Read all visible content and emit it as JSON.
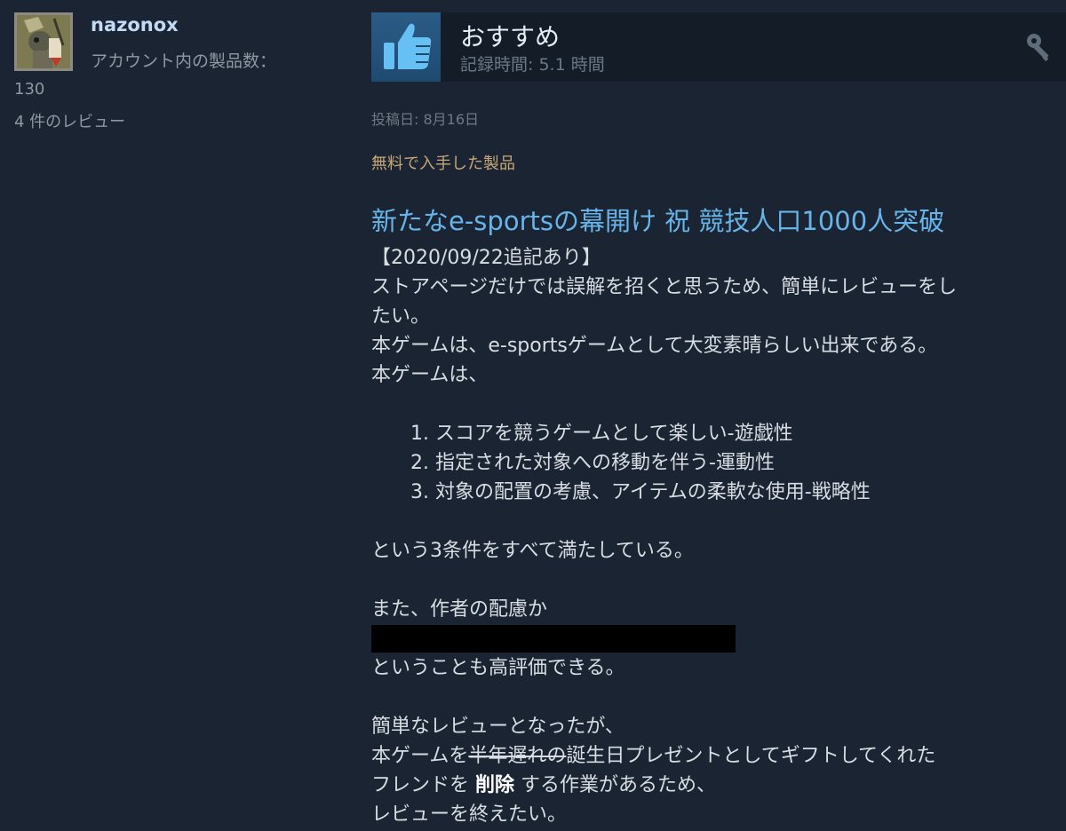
{
  "reviewer": {
    "name": "nazonox",
    "products_label": "アカウント内の製品数：",
    "products_count": "130",
    "review_count": "4 件のレビュー"
  },
  "review": {
    "recommendation": "おすすめ",
    "playtime": "記録時間: 5.1 時間",
    "posted": "投稿日: 8月16日",
    "free_product": "無料で入手した製品",
    "title": "新たなe-sportsの幕開け 祝 競技人口1000人突破",
    "body": {
      "line_update": "【2020/09/22追記あり】",
      "line_intro_1": "ストアページだけでは誤解を招くと思うため、簡単にレビューをし",
      "line_intro_2": "たい。",
      "line_praise": "本ゲームは、e-sportsゲームとして大変素晴らしい出来である。",
      "line_game": "本ゲームは、",
      "list": [
        "スコアを競うゲームとして楽しい-遊戯性",
        "指定された対象への移動を伴う-運動性",
        "対象の配置の考慮、アイテムの柔軟な使用-戦略性"
      ],
      "line_conditions": "という3条件をすべて満たしている。",
      "line_also": "また、作者の配慮か",
      "line_high_eval": "ということも高評価できる。",
      "line_short": "簡単なレビューとなったが、",
      "line_gift_prefix": "本ゲームを",
      "line_gift_strike": "半年遅れの",
      "line_gift_suffix": "誕生日プレゼントとしてギフトしてくれた",
      "line_friend_prefix": "フレンドを ",
      "line_friend_bold": "削除",
      "line_friend_suffix": " する作業があるため、",
      "line_end": "レビューを終えたい。"
    }
  },
  "colors": {
    "background": "#1b2433",
    "link_blue": "#66b4e8",
    "free_tag": "#c7a775",
    "thumb_blue": "#2b5c86"
  },
  "icons": {
    "thumb": "thumbs-up-icon",
    "key": "key-icon"
  }
}
